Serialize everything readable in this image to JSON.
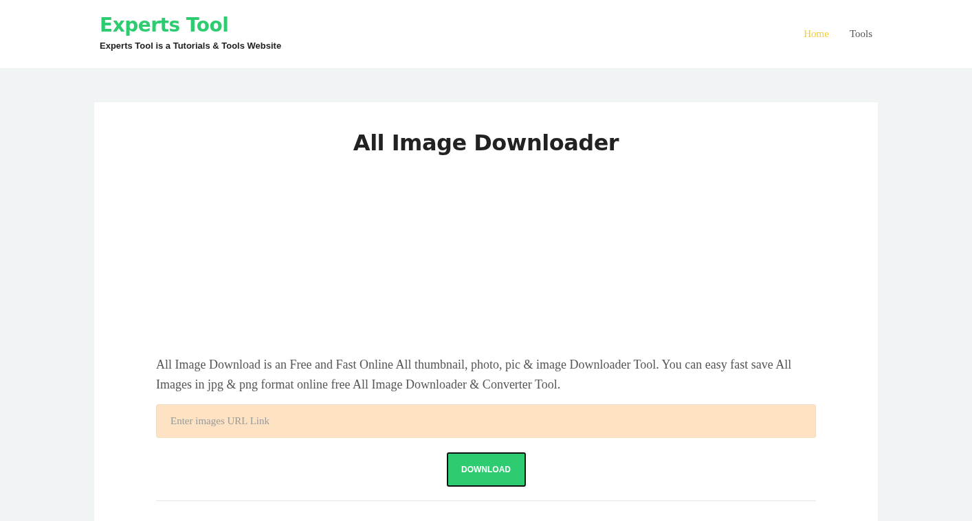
{
  "site": {
    "title": "Experts Tool",
    "tagline": "Experts Tool is a Tutorials & Tools Website"
  },
  "nav": [
    {
      "label": "Home",
      "selected": true
    },
    {
      "label": "Tools",
      "selected": false
    }
  ],
  "page": {
    "heading": "All Image Downloader",
    "description": "All Image Download is an Free and Fast Online All thumbnail, photo, pic & image Downloader Tool. You can easy fast save All Images in jpg & png format online free All Image Downloader & Converter Tool.",
    "url_field": {
      "placeholder": "Enter images URL Link"
    },
    "button": "DOWNLOAD"
  }
}
